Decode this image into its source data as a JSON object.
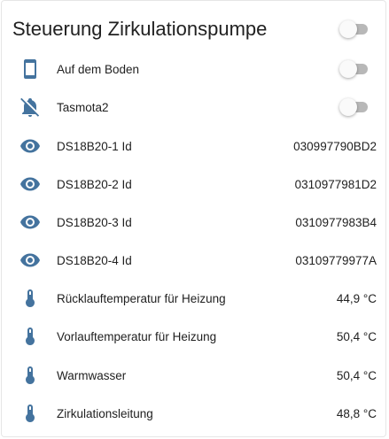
{
  "card": {
    "title": "Steuerung Zirkulationspumpe",
    "master_toggle_on": false
  },
  "colors": {
    "icon": "#44739e",
    "text": "#212121",
    "toggle_track_off": "#b8b8b8"
  },
  "rows": [
    {
      "label": "Auf dem Boden",
      "icon": "cellphone-icon",
      "type": "toggle",
      "on": false
    },
    {
      "label": "Tasmota2",
      "icon": "bell-off-icon",
      "type": "toggle",
      "on": false
    },
    {
      "label": "DS18B20-1 Id",
      "icon": "eye-icon",
      "type": "value",
      "value": "030997790BD2"
    },
    {
      "label": "DS18B20-2 Id",
      "icon": "eye-icon",
      "type": "value",
      "value": "0310977981D2"
    },
    {
      "label": "DS18B20-3 Id",
      "icon": "eye-icon",
      "type": "value",
      "value": "0310977983B4"
    },
    {
      "label": "DS18B20-4 Id",
      "icon": "eye-icon",
      "type": "value",
      "value": "03109779977A"
    },
    {
      "label": "Rücklauftemperatur für Heizung",
      "icon": "thermometer-icon",
      "type": "value",
      "value": "44,9 °C"
    },
    {
      "label": "Vorlauftemperatur für Heizung",
      "icon": "thermometer-icon",
      "type": "value",
      "value": "50,4 °C"
    },
    {
      "label": "Warmwasser",
      "icon": "thermometer-icon",
      "type": "value",
      "value": "50,4 °C"
    },
    {
      "label": "Zirkulationsleitung",
      "icon": "thermometer-icon",
      "type": "value",
      "value": "48,8 °C"
    }
  ]
}
